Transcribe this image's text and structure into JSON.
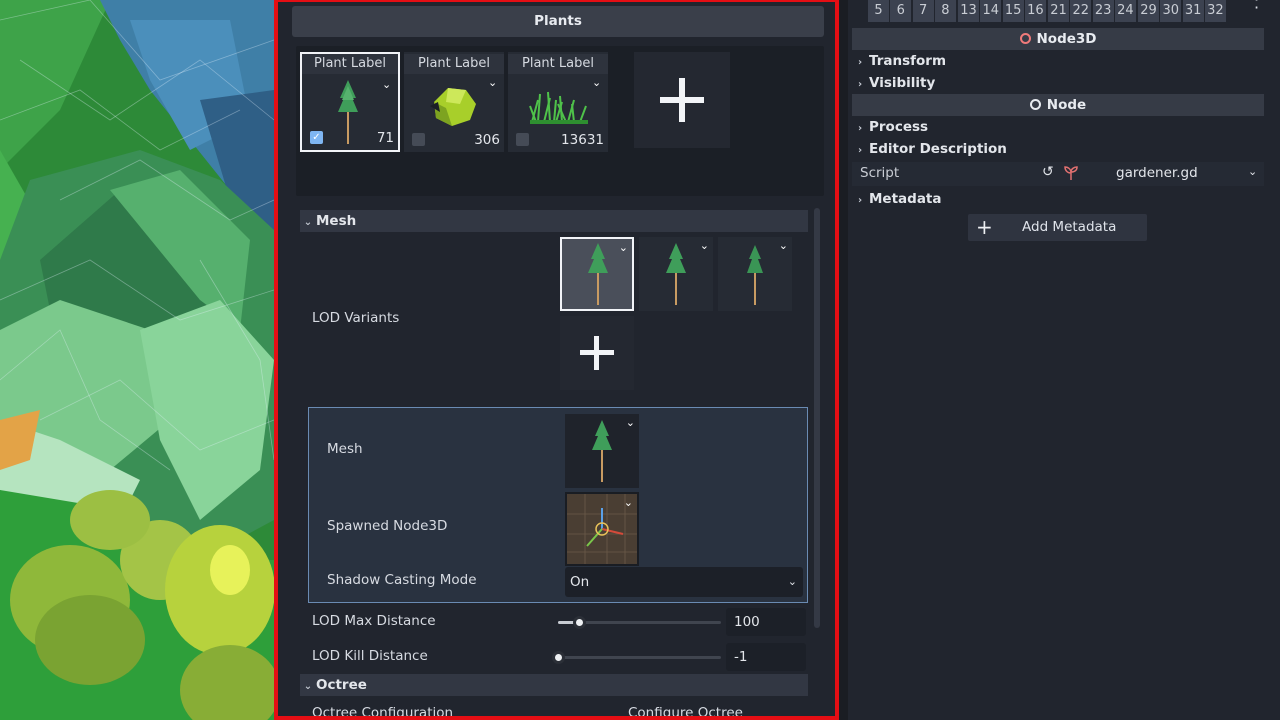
{
  "plants_panel": {
    "title": "Plants",
    "plants": [
      {
        "label": "Plant Label",
        "count": "71",
        "checked": true,
        "icon": "pine-tree-icon"
      },
      {
        "label": "Plant Label",
        "count": "306",
        "checked": false,
        "icon": "bush-icon"
      },
      {
        "label": "Plant Label",
        "count": "13631",
        "checked": false,
        "icon": "grass-icon"
      }
    ],
    "add_plant_icon": "plus-icon"
  },
  "mesh_section": {
    "header": "Mesh",
    "lod_variants_label": "LOD Variants",
    "sub": {
      "mesh_label": "Mesh",
      "spawned_label": "Spawned Node3D",
      "shadow_label": "Shadow Casting Mode",
      "shadow_value": "On"
    },
    "lod_max_label": "LOD Max Distance",
    "lod_max_value": "100",
    "lod_max_fraction": 0.13,
    "lod_kill_label": "LOD Kill Distance",
    "lod_kill_value": "-1",
    "lod_kill_fraction": 0.0
  },
  "octree_section": {
    "header": "Octree",
    "config_label": "Octree Configuration",
    "config_button": "Configure Octree"
  },
  "right_inspector": {
    "layers": [
      "5",
      "6",
      "7",
      "8",
      "13",
      "14",
      "15",
      "16",
      "21",
      "22",
      "23",
      "24",
      "29",
      "30",
      "31",
      "32"
    ],
    "node3d_header": "Node3D",
    "node3d_color": "#f07a7a",
    "transform": "Transform",
    "visibility": "Visibility",
    "node_header": "Node",
    "node_color": "#e8ebf0",
    "process": "Process",
    "editor_description": "Editor Description",
    "script_label": "Script",
    "script_value": "gardener.gd",
    "metadata": "Metadata",
    "add_metadata": "Add Metadata"
  }
}
